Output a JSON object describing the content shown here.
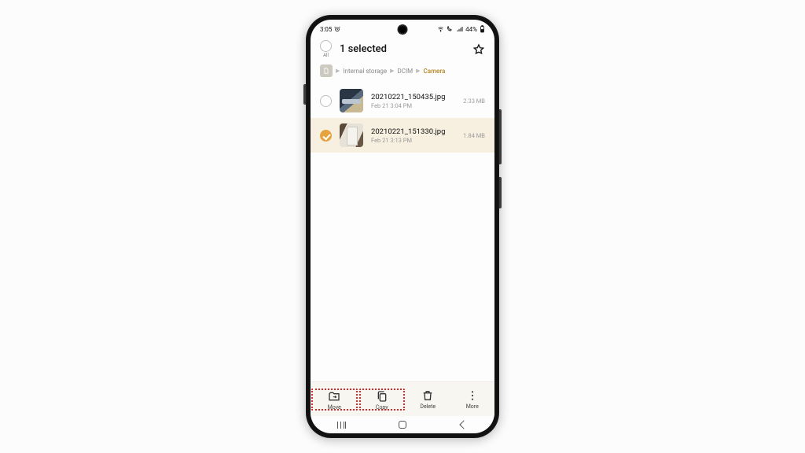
{
  "status": {
    "time": "3:05",
    "battery_pct": "44%"
  },
  "selection": {
    "title": "1 selected",
    "all_label": "All"
  },
  "breadcrumb": {
    "items": [
      "Internal storage",
      "DCIM",
      "Camera"
    ]
  },
  "files": [
    {
      "name": "20210221_150435.jpg",
      "date": "Feb 21 3:04 PM",
      "size": "2.33 MB",
      "selected": false
    },
    {
      "name": "20210221_151330.jpg",
      "date": "Feb 21 3:13 PM",
      "size": "1.84 MB",
      "selected": true
    }
  ],
  "actions": {
    "move": "Move",
    "copy": "Copy",
    "delete": "Delete",
    "more": "More"
  }
}
